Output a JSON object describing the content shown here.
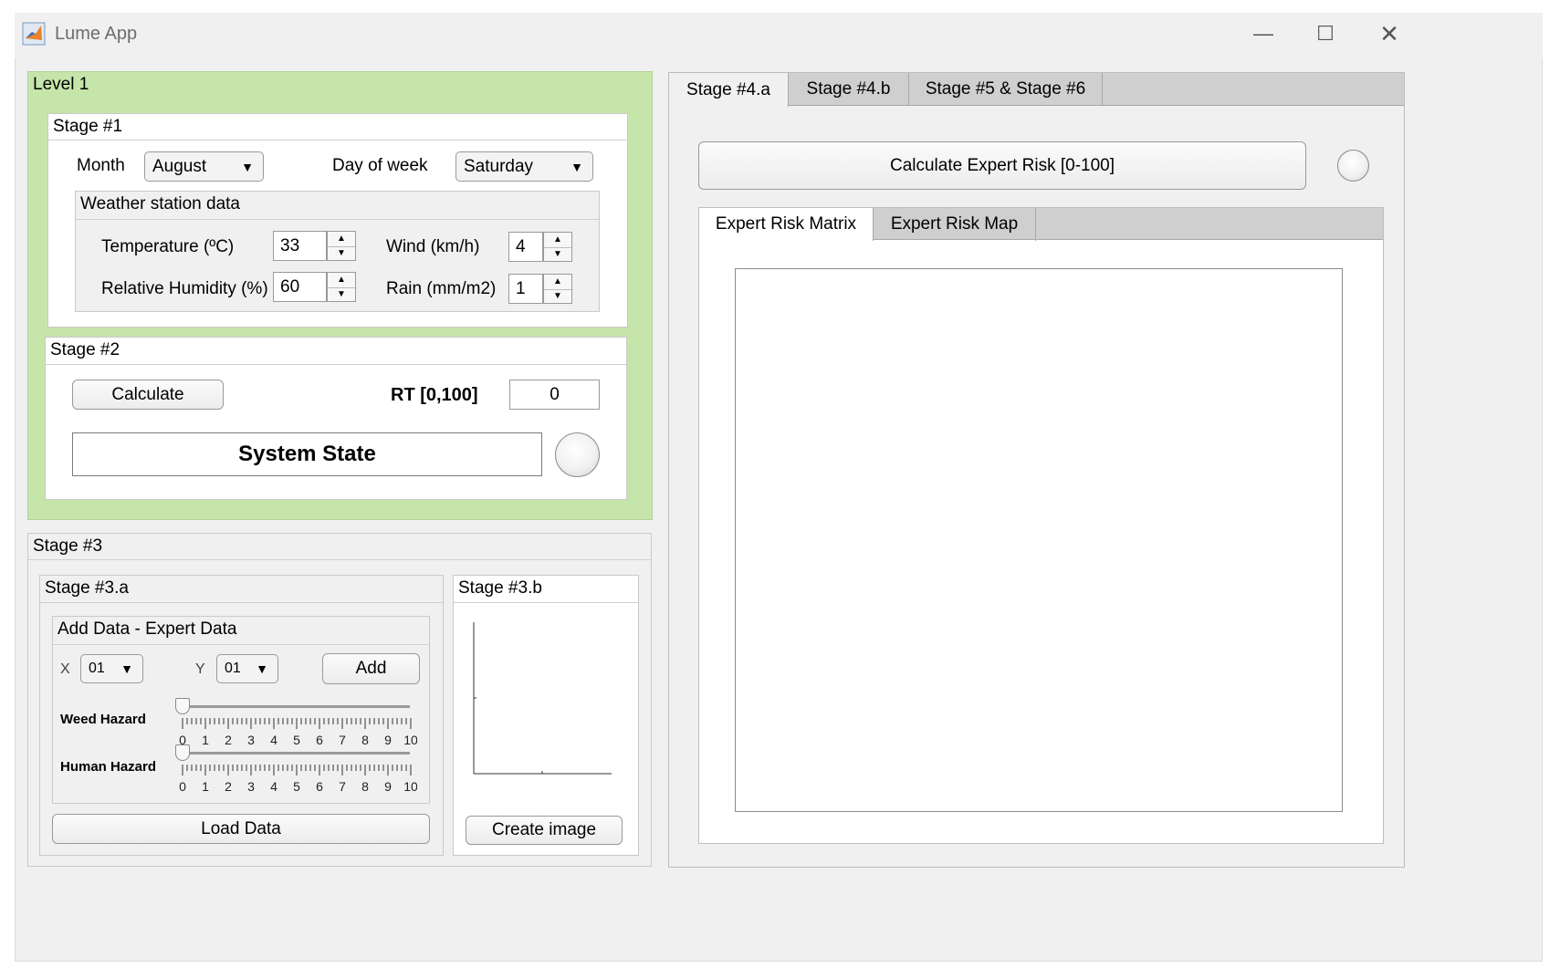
{
  "window": {
    "title": "Lume App"
  },
  "level1": {
    "title": "Level 1",
    "bg_color": "#c6e5aa"
  },
  "stage1": {
    "title": "Stage #1",
    "month_label": "Month",
    "month_value": "August",
    "day_label": "Day of week",
    "day_value": "Saturday",
    "weather": {
      "title": "Weather station data",
      "temperature_label": "Temperature (ºC)",
      "temperature_value": "33",
      "wind_label": "Wind (km/h)",
      "wind_value": "4",
      "humidity_label": "Relative Humidity (%)",
      "humidity_value": "60",
      "rain_label": "Rain (mm/m2)",
      "rain_value": "1"
    }
  },
  "stage2": {
    "title": "Stage #2",
    "calculate_label": "Calculate",
    "rt_label": "RT [0,100]",
    "rt_value": "0",
    "system_state_label": "System State"
  },
  "stage3": {
    "title": "Stage #3",
    "a": {
      "title": "Stage #3.a",
      "add_data_title": "Add Data - Expert Data",
      "x_label": "X",
      "x_value": "01",
      "y_label": "Y",
      "y_value": "01",
      "add_label": "Add",
      "weed_hazard_label": "Weed Hazard",
      "weed_hazard_value": 0,
      "human_hazard_label": "Human Hazard",
      "human_hazard_value": 0,
      "slider_ticks": [
        "0",
        "1",
        "2",
        "3",
        "4",
        "5",
        "6",
        "7",
        "8",
        "9",
        "10"
      ],
      "load_data_label": "Load Data"
    },
    "b": {
      "title": "Stage #3.b",
      "create_image_label": "Create image"
    }
  },
  "stage4": {
    "tabs": [
      "Stage #4.a",
      "Stage #4.b",
      "Stage #5 & Stage #6"
    ],
    "active_tab": 0,
    "calc_expert_label": "Calculate Expert Risk [0-100]",
    "subtabs": [
      "Expert Risk Matrix",
      "Expert Risk Map"
    ],
    "active_subtab": 0
  }
}
